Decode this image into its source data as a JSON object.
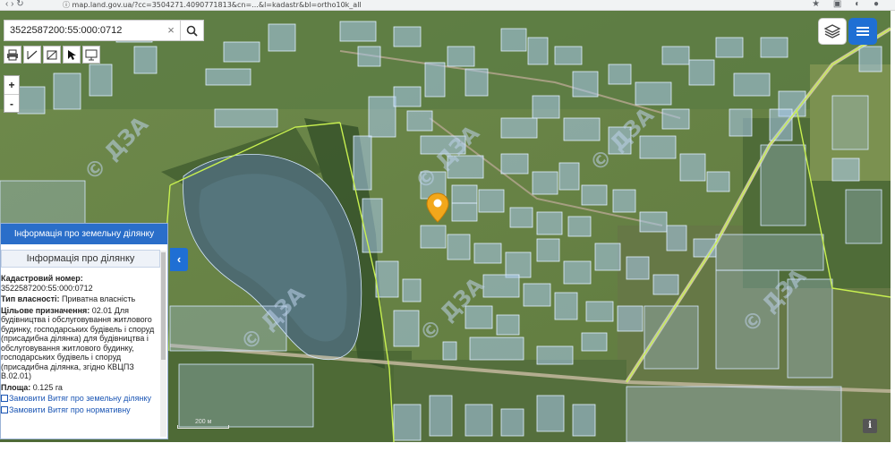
{
  "browser": {
    "nav_glyphs": "‹  ›  ↻",
    "url": "ⓘ map.land.gov.ua/?cc=3504271.4090771813&cn=...&l=kadastr&bl=ortho10k_all",
    "ext_glyphs": "★ ▣ ◐ ●"
  },
  "search": {
    "value": "3522587200:55:000:0712",
    "clear_glyph": "×"
  },
  "zoom": {
    "in": "+",
    "out": "-"
  },
  "watermark_text": "© ДЗА",
  "panel": {
    "header": "Інформація про земельну ділянку",
    "subheader": "Інформація про ділянку",
    "cadastral_label": "Кадастровий номер:",
    "cadastral_value": "3522587200:55:000:0712",
    "ownership_label": "Тип власності:",
    "ownership_value": "Приватна власність",
    "purpose_label": "Цільове призначення:",
    "purpose_value": "02.01 Для будівництва і обслуговування житлового будинку, господарських будівель і споруд (присадибна ділянка) для будівництва і обслуговування житлового будинку, господарських будівель і споруд (присадибна ділянка, згідно КВЦПЗ В.02.01)",
    "area_label": "Площа:",
    "area_value": "0.125 га",
    "link1": "Замовити Витяг про земельну ділянку",
    "link2": "Замовити Витяг про нормативну"
  },
  "collapse_glyph": "‹",
  "scale_label": "200 м",
  "info_glyph": "i",
  "colors": {
    "accent": "#1f6fd4",
    "parcel_fill": "#a8c8ec",
    "parcel_stroke": "#d6e8ff",
    "boundary": "#c8f050",
    "marker": "#f2a71b"
  }
}
